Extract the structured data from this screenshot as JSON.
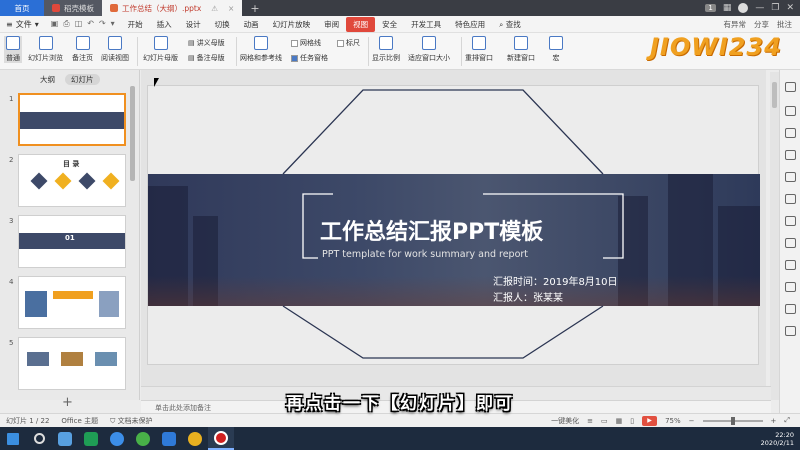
{
  "titlebar": {
    "home_tab": "首页",
    "tab_template": "稻壳模板",
    "tab_doc": "工作总结（大纲）.pptx",
    "badge": "1"
  },
  "menubar": {
    "file": "文件",
    "items": [
      "开始",
      "插入",
      "设计",
      "切换",
      "动画",
      "幻灯片放映",
      "审阅",
      "视图",
      "安全",
      "开发工具",
      "特色应用"
    ],
    "selected": "视图",
    "search": "查找",
    "right_items": [
      "有异常",
      "分享",
      "批注"
    ]
  },
  "ribbon": {
    "normal": "普通",
    "slide_browser": "幻灯片浏览",
    "notes_page": "备注页",
    "reading_view": "阅读视图",
    "slide_master": "幻灯片母版",
    "handout_master": "讲义母版",
    "notes_master": "备注母版",
    "grid_guides": "网格和参考线",
    "gridlines": "网格线",
    "ruler": "标尺",
    "task_pane": "任务窗格",
    "zoom": "显示比例",
    "fit_window": "适应窗口大小",
    "rearrange": "重排窗口",
    "new_window": "新建窗口",
    "macro": "宏"
  },
  "logo_text": "JIOWI234",
  "leftpanel": {
    "tab_outline": "大纲",
    "tab_slides": "幻灯片",
    "slide_numbers": [
      "1",
      "2",
      "3",
      "4",
      "5"
    ],
    "add": "+",
    "thumb2_title": "目 录",
    "thumb3_num": "01"
  },
  "slide": {
    "title": "工作总结汇报PPT模板",
    "subtitle": "PPT template for work summary and report",
    "date_line": "汇报时间：2019年8月10日",
    "reporter_line": "汇报人：张某某"
  },
  "notes_placeholder": "单击此处添加备注",
  "statusbar": {
    "slide_count": "幻灯片 1 / 22",
    "theme": "Office 主题",
    "protect": "文档未保护",
    "beautify": "一键美化",
    "zoom": "75%"
  },
  "taskbar": {
    "time": "22:20",
    "date": "2020/2/11"
  },
  "subtitle_caption": "再点击一下【幻灯片】即可",
  "colors": {
    "accent": "#e0483b",
    "band": "#3d4968",
    "home_tab": "#2b6fd6",
    "selected_thumb_border": "#f09020"
  }
}
